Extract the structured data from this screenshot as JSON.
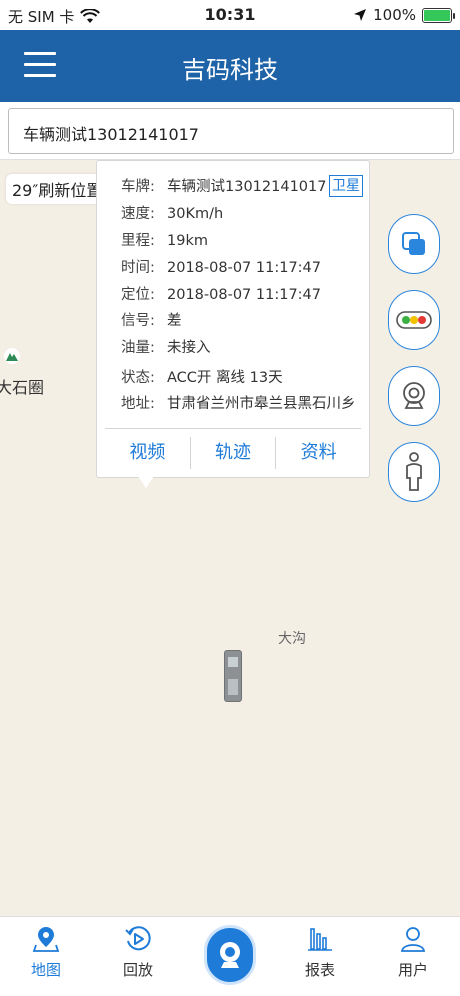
{
  "status_bar": {
    "carrier": "无 SIM 卡",
    "time": "10:31",
    "battery": "100%",
    "battery_level": 1.0
  },
  "header": {
    "title": "吉码科技"
  },
  "search": {
    "value": "车辆测试13012141017"
  },
  "map": {
    "refresh_text": "29″刷新位置",
    "poi_label": "大石圈",
    "place_label": "大沟"
  },
  "card": {
    "satellite_label": "卫星",
    "rows": [
      {
        "key": "车牌:",
        "value": "车辆测试13012141017"
      },
      {
        "key": "速度:",
        "value": "30Km/h"
      },
      {
        "key": "里程:",
        "value": "19km"
      },
      {
        "key": "时间:",
        "value": "2018-08-07 11:17:47"
      },
      {
        "key": "定位:",
        "value": "2018-08-07 11:17:47"
      },
      {
        "key": "信号:",
        "value": "差"
      },
      {
        "key": "油量:",
        "value": "未接入"
      },
      {
        "key": "状态:",
        "value": "ACC开 离线 13天"
      },
      {
        "key": "地址:",
        "value": "甘肃省兰州市皋兰县黑石川乡"
      }
    ],
    "actions": [
      "视频",
      "轨迹",
      "资料"
    ]
  },
  "tabs": [
    {
      "label": "地图",
      "icon": "map-pin-icon",
      "active": true
    },
    {
      "label": "回放",
      "icon": "playback-icon",
      "active": false
    },
    {
      "label": "报表",
      "icon": "bar-chart-icon",
      "active": false
    },
    {
      "label": "用户",
      "icon": "user-icon",
      "active": false
    }
  ],
  "colors": {
    "brand_blue": "#1e63a8",
    "accent_blue": "#1e7bd8",
    "map_bg": "#f4efe5"
  }
}
